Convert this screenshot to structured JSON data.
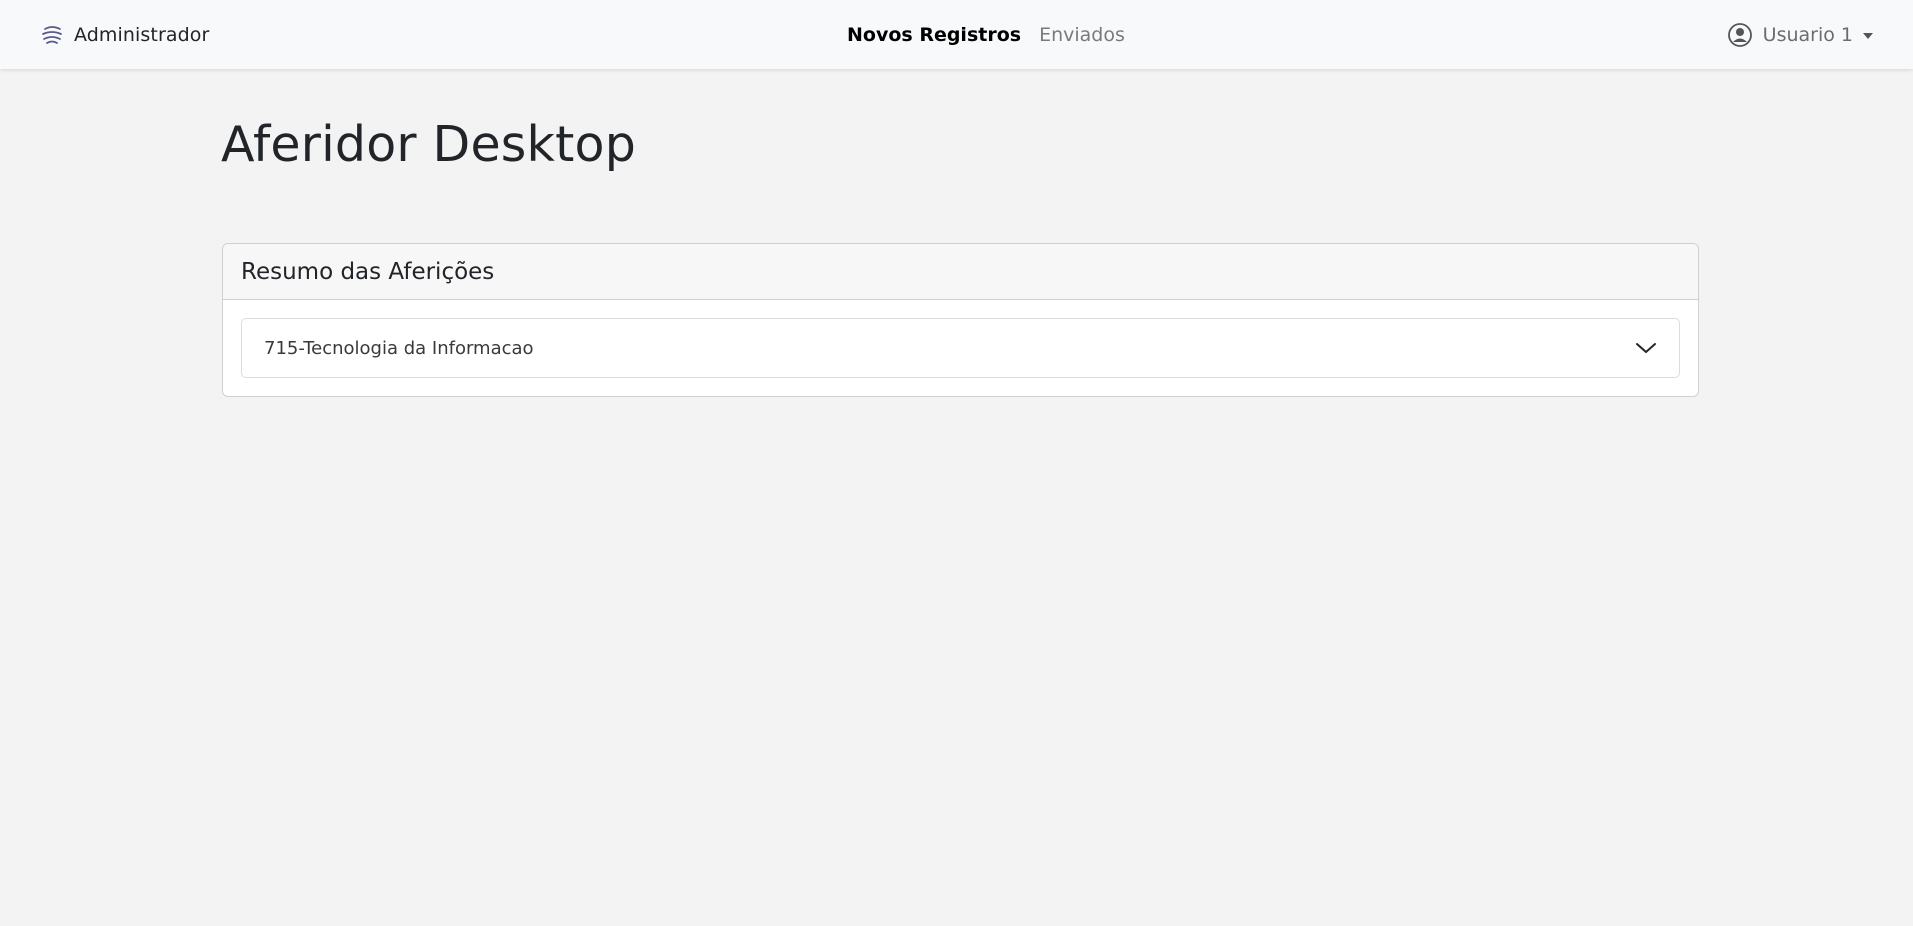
{
  "navbar": {
    "brand_label": "Administrador",
    "brand_icon": "layers-logo-icon",
    "links": [
      {
        "label": "Novos Registros",
        "active": true
      },
      {
        "label": "Enviados",
        "active": false
      }
    ],
    "user": {
      "name": "Usuario 1",
      "icon": "user-circle-icon"
    }
  },
  "main": {
    "title": "Aferidor Desktop",
    "card": {
      "title": "Resumo das Aferições",
      "accordion_items": [
        {
          "label": "715-Tecnologia da Informacao",
          "expanded": false
        }
      ]
    }
  },
  "colors": {
    "background": "#f3f3f3",
    "navbar": "#f8f9fa",
    "text": "#212529",
    "muted": "#7a7a7a",
    "logo": "#5a5a8a"
  }
}
